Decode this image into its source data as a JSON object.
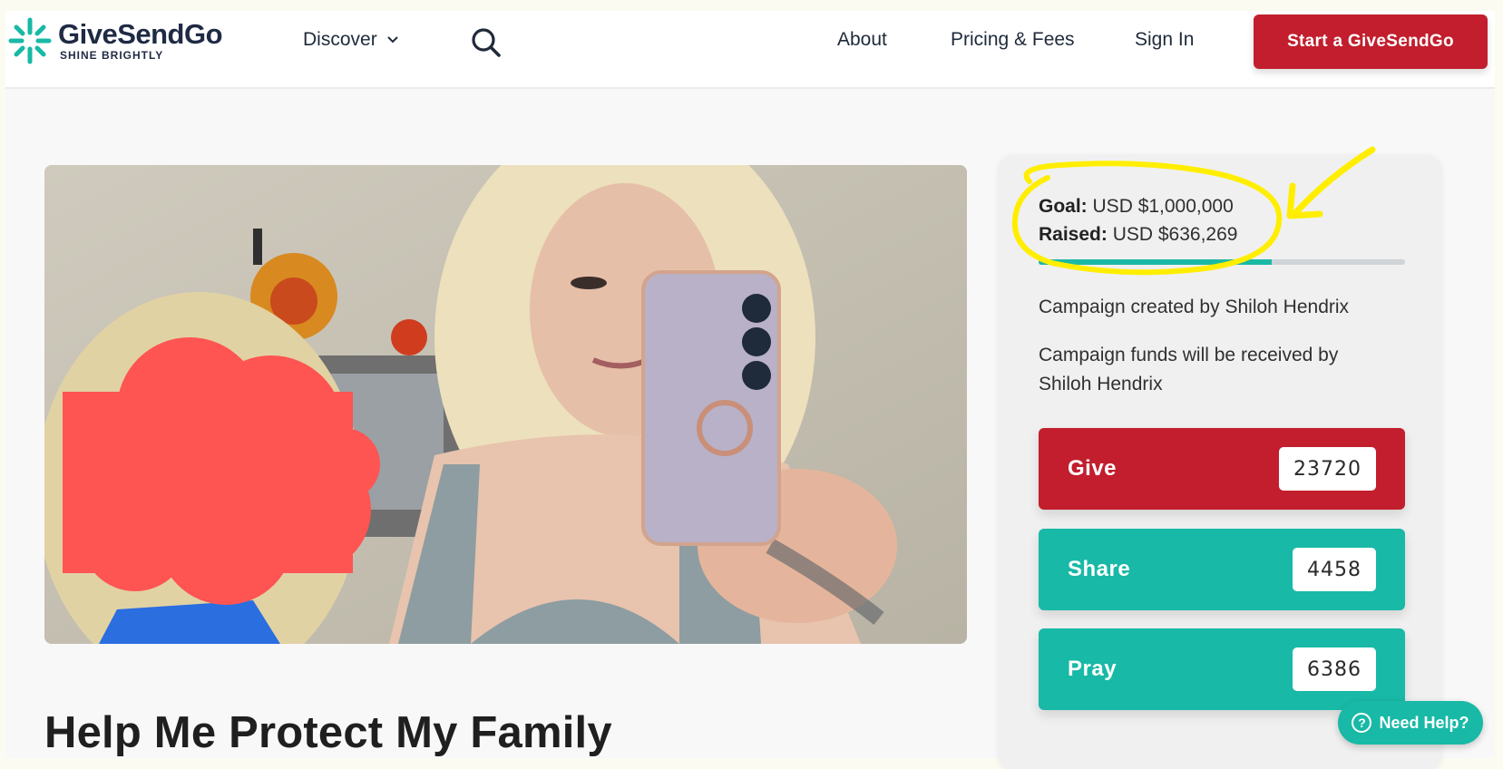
{
  "header": {
    "logo_name": "GiveSendGo",
    "logo_tagline": "SHINE BRIGHTLY",
    "discover_label": "Discover",
    "nav": {
      "about": "About",
      "pricing": "Pricing & Fees",
      "signin": "Sign In"
    },
    "start_button": "Start a GiveSendGo"
  },
  "campaign": {
    "title": "Help Me Protect My Family"
  },
  "sidebar": {
    "goal_label": "Goal:",
    "goal_value": "USD $1,000,000",
    "raised_label": "Raised:",
    "raised_value": "USD $636,269",
    "progress_fraction": 0.636,
    "created_prefix": "Campaign created by",
    "created_by": "Shiloh Hendrix",
    "received_prefix": "Campaign funds will be received by",
    "received_by": "Shiloh Hendrix",
    "actions": {
      "give": {
        "label": "Give",
        "count": "23720"
      },
      "share": {
        "label": "Share",
        "count": "4458"
      },
      "pray": {
        "label": "Pray",
        "count": "6386"
      }
    }
  },
  "help": {
    "label": "Need Help?"
  },
  "colors": {
    "brand_red": "#c21e2d",
    "brand_teal": "#18b9a6",
    "annotation_yellow": "#ffee00"
  }
}
